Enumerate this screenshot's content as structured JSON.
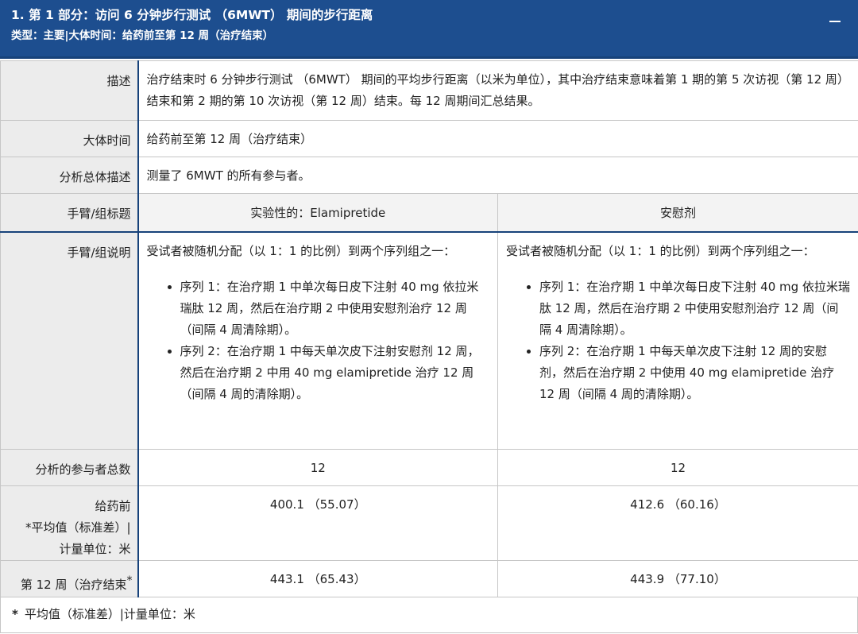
{
  "header": {
    "title": "1. 第 1 部分：访问 6 分钟步行测试 （6MWT） 期间的步行距离",
    "subtitle": "类型：主要|大体时间：给药前至第 12 周（治疗结束）"
  },
  "rows": {
    "description": {
      "label": "描述",
      "value": "治疗结束时 6 分钟步行测试 （6MWT） 期间的平均步行距离（以米为单位），其中治疗结束意味着第 1 期的第 5 次访视（第 12 周）结束和第 2 期的第 10 次访视（第 12 周）结束。每 12 周期间汇总结果。"
    },
    "timeframe": {
      "label": "大体时间",
      "value": "给药前至第 12 周（治疗结束）"
    },
    "population": {
      "label": "分析总体描述",
      "value": "测量了 6MWT 的所有参与者。"
    },
    "arm_title": {
      "label": "手臂/组标题",
      "arm1": "实验性的：Elamipretide",
      "arm2": "安慰剂"
    },
    "arm_desc": {
      "label": "手臂/组说明",
      "arm1": {
        "intro": "受试者被随机分配（以 1：1 的比例）到两个序列组之一：",
        "seq1": "序列 1：在治疗期 1 中单次每日皮下注射 40 mg 依拉米瑞肽 12 周，然后在治疗期 2 中使用安慰剂治疗 12 周（间隔 4 周清除期）。",
        "seq2": "序列 2：在治疗期 1 中每天单次皮下注射安慰剂 12 周，然后在治疗期 2 中用 40 mg elamipretide 治疗 12 周（间隔 4 周的清除期）。"
      },
      "arm2": {
        "intro": "受试者被随机分配（以 1：1 的比例）到两个序列组之一：",
        "seq1": "序列 1：在治疗期 1 中单次每日皮下注射 40 mg 依拉米瑞肽 12 周，然后在治疗期 2 中使用安慰剂治疗 12 周（间隔 4 周清除期）。",
        "seq2": "序列 2：在治疗期 1 中每天单次皮下注射 12 周的安慰剂，然后在治疗期 2 中使用 40 mg elamipretide 治疗 12 周（间隔 4 周的清除期）。"
      }
    },
    "participants": {
      "label": "分析的参与者总数",
      "arm1": "12",
      "arm2": "12"
    },
    "predose": {
      "label_line1": "给药前",
      "label_line2": "*平均值（标准差）|",
      "label_line3": "计量单位：米",
      "arm1": "400.1 （55.07）",
      "arm2": "412.6 （60.16）"
    },
    "week12": {
      "label": "第 12 周（治疗结束",
      "label_star": "*",
      "arm1": "443.1 （65.43）",
      "arm2": "443.9 （77.10）"
    }
  },
  "footnote": {
    "star": "*",
    "text": "平均值（标准差）|计量单位：米"
  },
  "colors": {
    "header_bg": "#1d4e8f",
    "label_bg": "#ececec",
    "accent_border": "#17427a"
  }
}
